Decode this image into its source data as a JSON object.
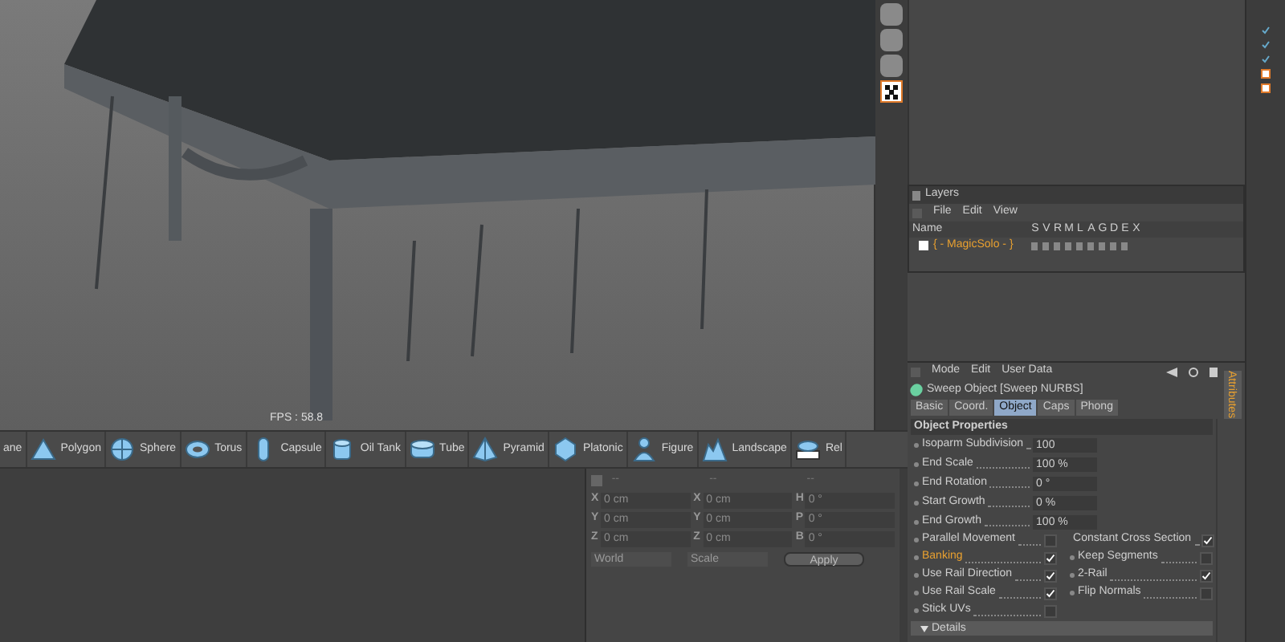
{
  "viewport": {
    "fps": "FPS : 58.8"
  },
  "object_toolbar": [
    {
      "label": "ane",
      "kind": "plane"
    },
    {
      "label": "Polygon",
      "kind": "polygon"
    },
    {
      "label": "Sphere",
      "kind": "sphere"
    },
    {
      "label": "Torus",
      "kind": "torus"
    },
    {
      "label": "Capsule",
      "kind": "capsule"
    },
    {
      "label": "Oil Tank",
      "kind": "oiltank"
    },
    {
      "label": "Tube",
      "kind": "tube"
    },
    {
      "label": "Pyramid",
      "kind": "pyramid"
    },
    {
      "label": "Platonic",
      "kind": "platonic"
    },
    {
      "label": "Figure",
      "kind": "figure"
    },
    {
      "label": "Landscape",
      "kind": "landscape"
    },
    {
      "label": "Rel",
      "kind": "relief"
    }
  ],
  "coordinates": {
    "headers": [
      "--",
      "--",
      "--"
    ],
    "columns": [
      [
        {
          "axis": "X",
          "value": "0 cm"
        },
        {
          "axis": "Y",
          "value": "0 cm"
        },
        {
          "axis": "Z",
          "value": "0 cm"
        }
      ],
      [
        {
          "axis": "X",
          "value": "0 cm"
        },
        {
          "axis": "Y",
          "value": "0 cm"
        },
        {
          "axis": "Z",
          "value": "0 cm"
        }
      ],
      [
        {
          "axis": "H",
          "value": "0 °"
        },
        {
          "axis": "P",
          "value": "0 °"
        },
        {
          "axis": "B",
          "value": "0 °"
        }
      ]
    ],
    "dropdowns": [
      "World",
      "Scale"
    ],
    "apply": "Apply"
  },
  "layers": {
    "title": "Layers",
    "menu": [
      "File",
      "Edit",
      "View"
    ],
    "columns": [
      "Name",
      "S",
      "V",
      "R",
      "M",
      "L",
      "A",
      "G",
      "D",
      "E",
      "X"
    ],
    "rows": [
      {
        "name": "{ - MagicSolo - }"
      }
    ]
  },
  "attributes": {
    "menu": [
      "Mode",
      "Edit",
      "User Data"
    ],
    "object": "Sweep Object [Sweep NURBS]",
    "tabs": [
      {
        "label": "Basic",
        "selected": false
      },
      {
        "label": "Coord.",
        "selected": false
      },
      {
        "label": "Object",
        "selected": true
      },
      {
        "label": "Caps",
        "selected": false
      },
      {
        "label": "Phong",
        "selected": false
      }
    ],
    "section": "Object Properties",
    "fields": [
      {
        "label": "Isoparm Subdivision",
        "value": "100"
      },
      {
        "label": "End Scale",
        "value": "100 %"
      },
      {
        "label": "End Rotation",
        "value": "0 °"
      },
      {
        "label": "Start Growth",
        "value": "0 %"
      },
      {
        "label": "End Growth",
        "value": "100 %"
      }
    ],
    "checks": [
      {
        "label": "Parallel Movement",
        "checked": false,
        "highlighted": false
      },
      {
        "label": "Constant Cross Section",
        "checked": true,
        "highlighted": false
      },
      {
        "label": "Banking",
        "checked": true,
        "highlighted": true
      },
      {
        "label": "Keep Segments",
        "checked": false,
        "highlighted": false
      },
      {
        "label": "Use Rail Direction",
        "checked": true,
        "highlighted": false
      },
      {
        "label": "2-Rail",
        "checked": true,
        "highlighted": false
      },
      {
        "label": "Use Rail Scale",
        "checked": true,
        "highlighted": false
      },
      {
        "label": "Flip Normals",
        "checked": false,
        "highlighted": false
      },
      {
        "label": "Stick UVs",
        "checked": false,
        "highlighted": false
      }
    ],
    "details": "Details",
    "side_tab": "Attributes"
  }
}
